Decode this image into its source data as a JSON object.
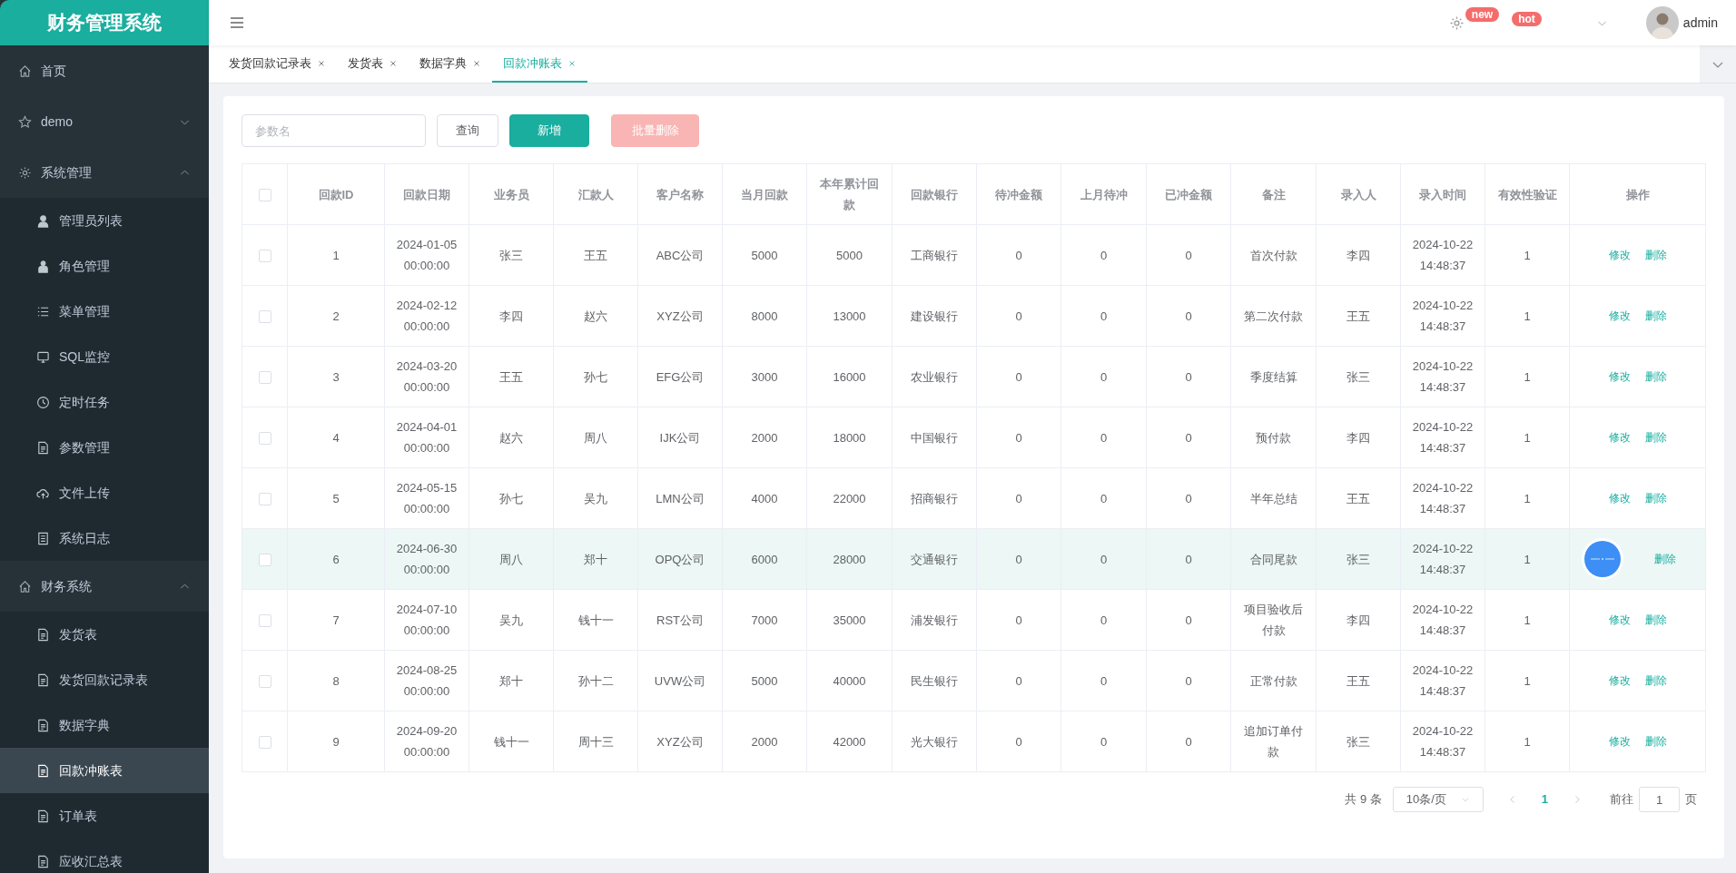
{
  "app_title": "财务管理系统",
  "sidebar": {
    "items": [
      {
        "label": "首页",
        "selected": false
      },
      {
        "label": "demo",
        "expanded": false,
        "selected": false
      },
      {
        "label": "系统管理",
        "expanded": true,
        "selected": false,
        "children": [
          {
            "label": "管理员列表",
            "selected": false
          },
          {
            "label": "角色管理",
            "selected": false
          },
          {
            "label": "菜单管理",
            "selected": false
          },
          {
            "label": "SQL监控",
            "selected": false
          },
          {
            "label": "定时任务",
            "selected": false
          },
          {
            "label": "参数管理",
            "selected": false
          },
          {
            "label": "文件上传",
            "selected": false
          },
          {
            "label": "系统日志",
            "selected": false
          }
        ]
      },
      {
        "label": "财务系统",
        "expanded": true,
        "selected": false,
        "children": [
          {
            "label": "发货表",
            "selected": false
          },
          {
            "label": "发货回款记录表",
            "selected": false
          },
          {
            "label": "数据字典",
            "selected": false
          },
          {
            "label": "回款冲账表",
            "selected": true
          },
          {
            "label": "订单表",
            "selected": false
          },
          {
            "label": "应收汇总表",
            "selected": false
          }
        ]
      }
    ]
  },
  "header": {
    "badges": [
      "new",
      "hot"
    ],
    "user": "admin"
  },
  "tabs": [
    {
      "label": "发货回款记录表",
      "selected": false
    },
    {
      "label": "发货表",
      "selected": false
    },
    {
      "label": "数据字典",
      "selected": false
    },
    {
      "label": "回款冲账表",
      "selected": true
    }
  ],
  "toolbar": {
    "search": {
      "placeholder": "参数名"
    },
    "buttons": [
      {
        "label": "查询",
        "kind": "default",
        "disabled": false
      },
      {
        "label": "新增",
        "kind": "primary",
        "disabled": false
      },
      {
        "label": "批量删除",
        "kind": "danger",
        "disabled": true
      }
    ]
  },
  "table": {
    "all_checked": false,
    "columns": [
      "回款ID",
      "回款日期",
      "业务员",
      "汇款人",
      "客户名称",
      "当月回款",
      "本年累计回款",
      "回款银行",
      "待冲金额",
      "上月待冲",
      "已冲金额",
      "备注",
      "录入人",
      "录入时间",
      "有效性验证",
      "操作"
    ],
    "rows": [
      {
        "checked": false,
        "highlighted": false,
        "floating_button": false,
        "cells": [
          "1",
          "2024-01-05 00:00:00",
          "张三",
          "王五",
          "ABC公司",
          "5000",
          "5000",
          "工商银行",
          "0",
          "0",
          "0",
          "首次付款",
          "李四",
          "2024-10-22 14:48:37",
          "1"
        ],
        "actions": [
          "修改",
          "删除"
        ]
      },
      {
        "checked": false,
        "highlighted": false,
        "floating_button": false,
        "cells": [
          "2",
          "2024-02-12 00:00:00",
          "李四",
          "赵六",
          "XYZ公司",
          "8000",
          "13000",
          "建设银行",
          "0",
          "0",
          "0",
          "第二次付款",
          "王五",
          "2024-10-22 14:48:37",
          "1"
        ],
        "actions": [
          "修改",
          "删除"
        ]
      },
      {
        "checked": false,
        "highlighted": false,
        "floating_button": false,
        "cells": [
          "3",
          "2024-03-20 00:00:00",
          "王五",
          "孙七",
          "EFG公司",
          "3000",
          "16000",
          "农业银行",
          "0",
          "0",
          "0",
          "季度结算",
          "张三",
          "2024-10-22 14:48:37",
          "1"
        ],
        "actions": [
          "修改",
          "删除"
        ]
      },
      {
        "checked": false,
        "highlighted": false,
        "floating_button": false,
        "cells": [
          "4",
          "2024-04-01 00:00:00",
          "赵六",
          "周八",
          "IJK公司",
          "2000",
          "18000",
          "中国银行",
          "0",
          "0",
          "0",
          "预付款",
          "李四",
          "2024-10-22 14:48:37",
          "1"
        ],
        "actions": [
          "修改",
          "删除"
        ]
      },
      {
        "checked": false,
        "highlighted": false,
        "floating_button": false,
        "cells": [
          "5",
          "2024-05-15 00:00:00",
          "孙七",
          "吴九",
          "LMN公司",
          "4000",
          "22000",
          "招商银行",
          "0",
          "0",
          "0",
          "半年总结",
          "王五",
          "2024-10-22 14:48:37",
          "1"
        ],
        "actions": [
          "修改",
          "删除"
        ]
      },
      {
        "checked": false,
        "highlighted": true,
        "floating_button": true,
        "cells": [
          "6",
          "2024-06-30 00:00:00",
          "周八",
          "郑十",
          "OPQ公司",
          "6000",
          "28000",
          "交通银行",
          "0",
          "0",
          "0",
          "合同尾款",
          "张三",
          "2024-10-22 14:48:37",
          "1"
        ],
        "actions": [
          "删除"
        ]
      },
      {
        "checked": false,
        "highlighted": false,
        "floating_button": false,
        "cells": [
          "7",
          "2024-07-10 00:00:00",
          "吴九",
          "钱十一",
          "RST公司",
          "7000",
          "35000",
          "浦发银行",
          "0",
          "0",
          "0",
          "项目验收后付款",
          "李四",
          "2024-10-22 14:48:37",
          "1"
        ],
        "actions": [
          "修改",
          "删除"
        ]
      },
      {
        "checked": false,
        "highlighted": false,
        "floating_button": false,
        "cells": [
          "8",
          "2024-08-25 00:00:00",
          "郑十",
          "孙十二",
          "UVW公司",
          "5000",
          "40000",
          "民生银行",
          "0",
          "0",
          "0",
          "正常付款",
          "王五",
          "2024-10-22 14:48:37",
          "1"
        ],
        "actions": [
          "修改",
          "删除"
        ]
      },
      {
        "checked": false,
        "highlighted": false,
        "floating_button": false,
        "cells": [
          "9",
          "2024-09-20 00:00:00",
          "钱十一",
          "周十三",
          "XYZ公司",
          "2000",
          "42000",
          "光大银行",
          "0",
          "0",
          "0",
          "追加订单付款",
          "张三",
          "2024-10-22 14:48:37",
          "1"
        ],
        "actions": [
          "修改",
          "删除"
        ]
      }
    ]
  },
  "pagination": {
    "total": "共 9 条",
    "page_size": "10条/页",
    "pages": [
      {
        "label": "1",
        "selected": true
      }
    ],
    "goto_label": "前往",
    "goto_value": "1",
    "page_suffix": "页"
  }
}
